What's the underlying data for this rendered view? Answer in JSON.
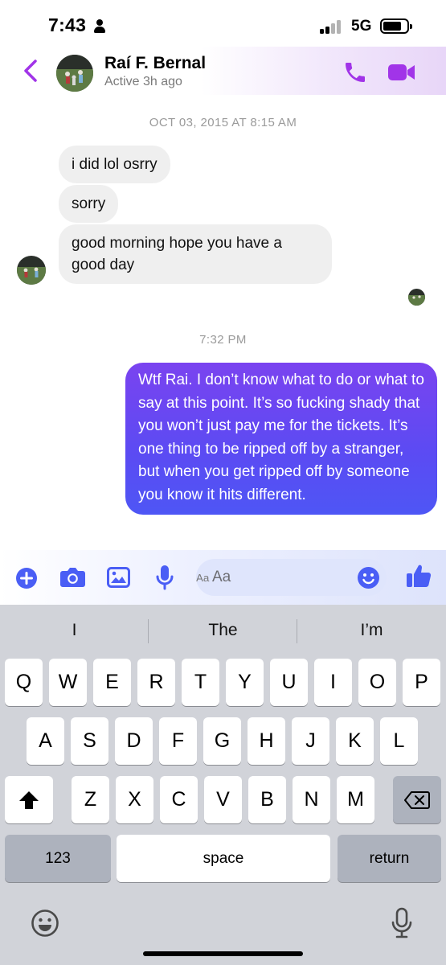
{
  "status_bar": {
    "time": "7:43",
    "network": "5G",
    "icons": [
      "person-icon",
      "signal-icon",
      "battery-icon"
    ]
  },
  "header": {
    "contact_name": "Raí F. Bernal",
    "active_status": "Active 3h ago",
    "icons": [
      "back-chevron-icon",
      "phone-icon",
      "video-camera-icon"
    ],
    "accent_color": "#a134e8"
  },
  "thread": {
    "timestamp_1": "OCT 03, 2015 AT 8:15 AM",
    "incoming": [
      {
        "text": "i did lol osrry"
      },
      {
        "text": "sorry"
      },
      {
        "text": "good morning hope you have a good day"
      }
    ],
    "timestamp_2": "7:32 PM",
    "outgoing": [
      {
        "text": "Wtf Rai. I don’t know what to do or what to say at this point. It’s so fucking shady that you won’t just pay me for the tickets. It’s one thing to be ripped off by a stranger, but when you get ripped off by someone you know it hits different."
      }
    ]
  },
  "composer": {
    "placeholder": "Aa",
    "icons": [
      "plus-icon",
      "camera-icon",
      "photo-icon",
      "microphone-icon",
      "emoji-icon",
      "thumbs-up-icon"
    ],
    "accent_color": "#4a5ef5"
  },
  "keyboard": {
    "suggestions": [
      "I",
      "The",
      "I’m"
    ],
    "row1": [
      "Q",
      "W",
      "E",
      "R",
      "T",
      "Y",
      "U",
      "I",
      "O",
      "P"
    ],
    "row2": [
      "A",
      "S",
      "D",
      "F",
      "G",
      "H",
      "J",
      "K",
      "L"
    ],
    "row3": [
      "Z",
      "X",
      "C",
      "V",
      "B",
      "N",
      "M"
    ],
    "numbers_label": "123",
    "space_label": "space",
    "return_label": "return"
  }
}
